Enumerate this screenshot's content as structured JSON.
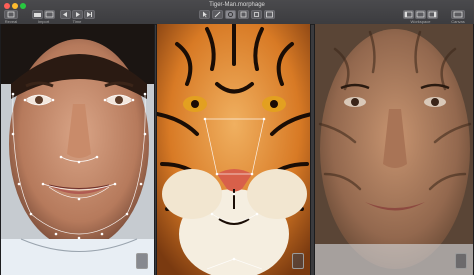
{
  "window": {
    "title": "Tiger-Man.morphage"
  },
  "toolbar": {
    "left": [
      {
        "name": "reveal",
        "label": "Reveal"
      },
      {
        "name": "import",
        "label": "Import"
      },
      {
        "name": "time",
        "label": "Time"
      }
    ],
    "right": [
      {
        "name": "workspace",
        "label": "Workspace"
      },
      {
        "name": "canvas",
        "label": "Canvas"
      }
    ]
  },
  "icons": {
    "close": "close-icon",
    "minimize": "minimize-icon",
    "zoom": "zoom-icon",
    "rewind": "rewind-icon",
    "play": "play-icon",
    "forward": "forward-icon",
    "pointer": "pointer-icon",
    "pen": "pen-icon",
    "node": "node-icon",
    "crop": "crop-icon",
    "image": "image-icon"
  }
}
